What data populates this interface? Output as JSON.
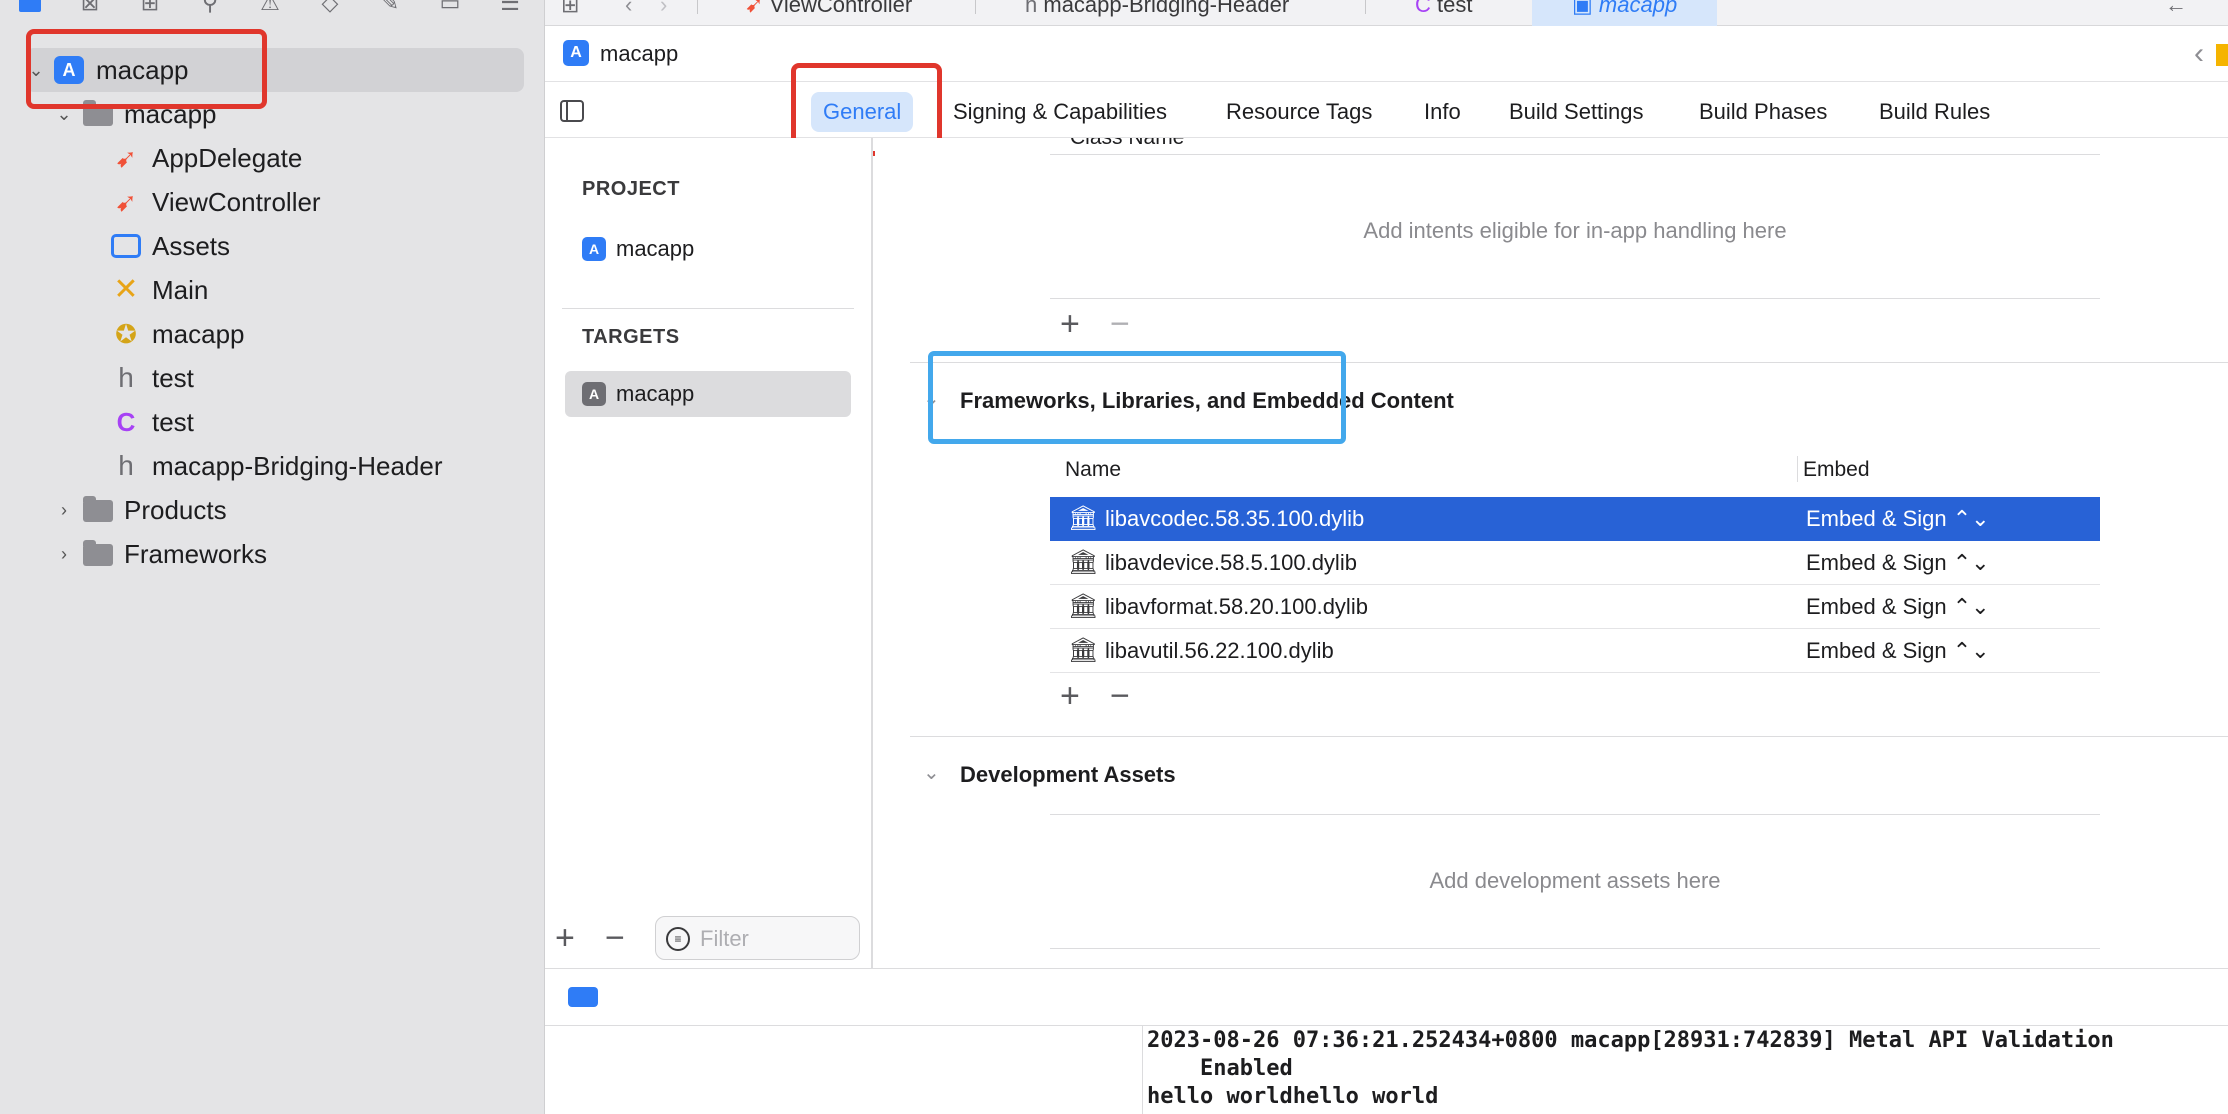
{
  "navigator": {
    "items": [
      {
        "label": "macapp",
        "icon": "app-icon",
        "disclosure": "chevron-down-icon"
      },
      {
        "label": "macapp",
        "icon": "folder-icon",
        "disclosure": "chevron-down-icon"
      },
      {
        "label": "AppDelegate",
        "icon": "swift-icon"
      },
      {
        "label": "ViewController",
        "icon": "swift-icon"
      },
      {
        "label": "Assets",
        "icon": "assets-icon"
      },
      {
        "label": "Main",
        "icon": "storyboard-icon"
      },
      {
        "label": "macapp",
        "icon": "entitlements-icon"
      },
      {
        "label": "test",
        "icon": "header-file-icon"
      },
      {
        "label": "test",
        "icon": "c-file-icon"
      },
      {
        "label": "macapp-Bridging-Header",
        "icon": "header-file-icon"
      },
      {
        "label": "Products",
        "icon": "folder-icon",
        "disclosure": "chevron-right-icon"
      },
      {
        "label": "Frameworks",
        "icon": "folder-icon",
        "disclosure": "chevron-right-icon"
      }
    ]
  },
  "tabs": [
    {
      "label": "ViewController",
      "icon": "swift-icon"
    },
    {
      "label": "macapp-Bridging-Header",
      "icon": "header-file-icon"
    },
    {
      "label": "test",
      "icon": "c-file-icon"
    },
    {
      "label": "macapp",
      "icon": "app-icon",
      "active": true
    }
  ],
  "jumpbar": {
    "title": "macapp"
  },
  "settings_tabs": [
    {
      "label": "General",
      "active": true
    },
    {
      "label": "Signing & Capabilities"
    },
    {
      "label": "Resource Tags"
    },
    {
      "label": "Info"
    },
    {
      "label": "Build Settings"
    },
    {
      "label": "Build Phases"
    },
    {
      "label": "Build Rules"
    }
  ],
  "target_list": {
    "project_header": "PROJECT",
    "project_item": "macapp",
    "targets_header": "TARGETS",
    "target_item": "macapp",
    "filter_placeholder": "Filter"
  },
  "content": {
    "class_name_header": "Class Name",
    "intents_placeholder": "Add intents eligible for in-app handling here",
    "frameworks_section_title": "Frameworks, Libraries, and Embedded Content",
    "col_name": "Name",
    "col_embed": "Embed",
    "frameworks": [
      {
        "name": "libavcodec.58.35.100.dylib",
        "embed": "Embed & Sign ⌃⌄",
        "selected": true
      },
      {
        "name": "libavdevice.58.5.100.dylib",
        "embed": "Embed & Sign ⌃⌄"
      },
      {
        "name": "libavformat.58.20.100.dylib",
        "embed": "Embed & Sign ⌃⌄"
      },
      {
        "name": "libavutil.56.22.100.dylib",
        "embed": "Embed & Sign ⌃⌄"
      }
    ],
    "dev_assets_title": "Development Assets",
    "dev_assets_placeholder": "Add development assets here"
  },
  "console": {
    "lines": [
      "2023-08-26 07:36:21.252434+0800 macapp[28931:742839] Metal API Validation",
      "    Enabled",
      "hello worldhello world"
    ]
  },
  "colors": {
    "accent": "#2f7cf6",
    "selection": "#2862d6",
    "highlight_red": "#e0362c",
    "highlight_blue": "#43a8ec"
  }
}
